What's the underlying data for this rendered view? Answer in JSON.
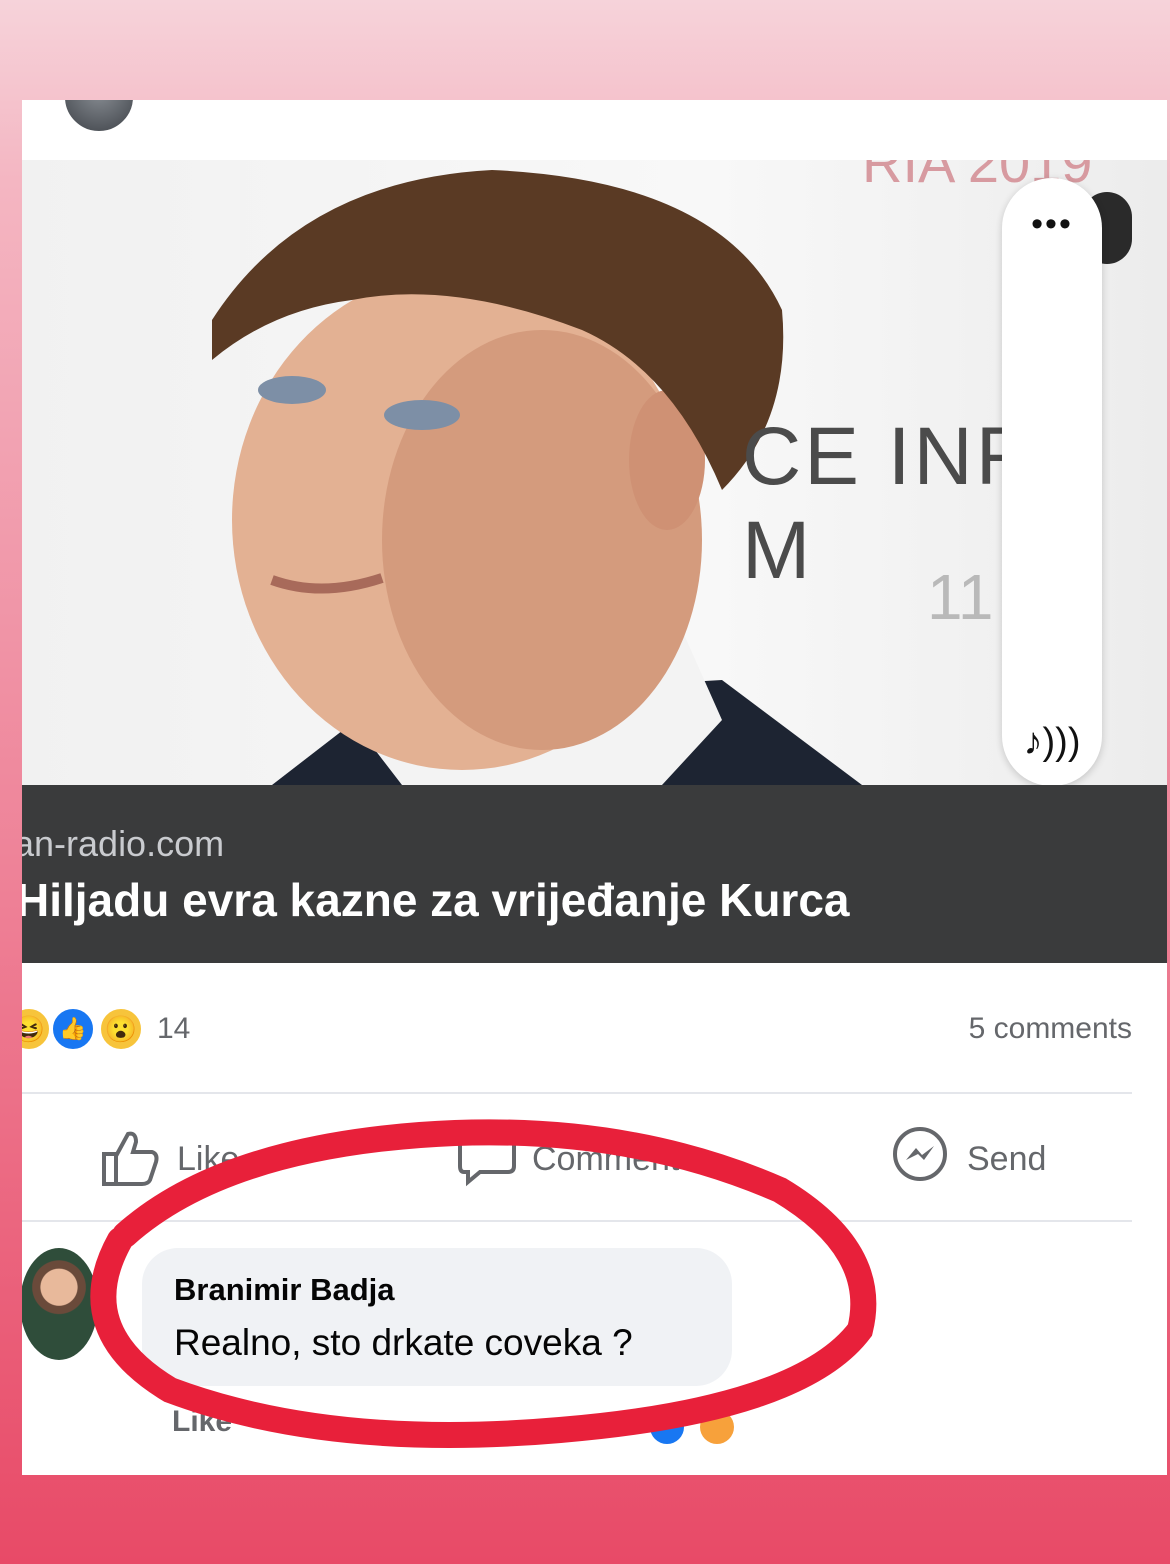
{
  "post": {
    "link_domain": "an-radio.com",
    "link_headline": "Hiljadu evra kazne za vrijeđanje Kurca",
    "photo_text_main": "CE INFO M",
    "photo_text_sub": "11 uly",
    "reaction_count": "14",
    "comments_count": "5 comments"
  },
  "actions": {
    "like_label": "Like",
    "comment_label": "Comment",
    "send_label": "Send"
  },
  "comment": {
    "author": "Branimir Badja",
    "text": "Realno, sto drkate coveka ?",
    "reply_like": "Like"
  },
  "icons": {
    "more": "more-dots-icon",
    "sound": "music-note-icon",
    "like": "thumbs-up-icon",
    "comment": "speech-bubble-icon",
    "send": "messenger-icon"
  },
  "colors": {
    "annotation_circle": "#e8203a",
    "link_box_bg": "#3a3b3c",
    "reaction_blue": "#1877f2"
  }
}
